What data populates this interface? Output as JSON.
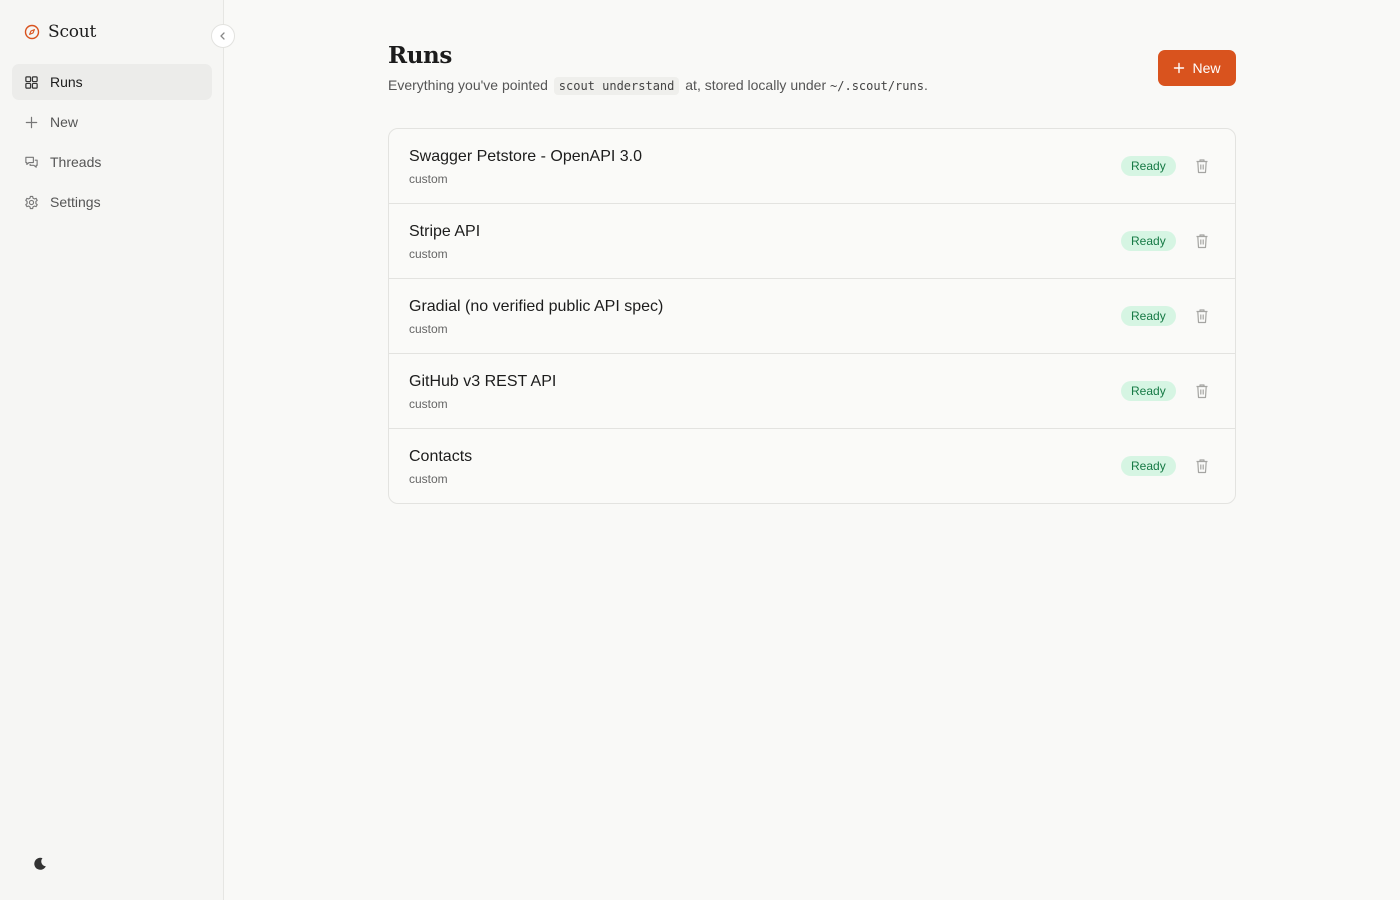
{
  "app": {
    "name": "Scout",
    "brand_icon": "compass-icon",
    "accent_color": "#d9531e"
  },
  "sidebar": {
    "items": [
      {
        "label": "Runs",
        "icon": "grid-icon",
        "active": true
      },
      {
        "label": "New",
        "icon": "plus-icon",
        "active": false
      },
      {
        "label": "Threads",
        "icon": "chat-bubbles-icon",
        "active": false
      },
      {
        "label": "Settings",
        "icon": "gear-icon",
        "active": false
      }
    ],
    "collapse_icon": "chevron-left-icon",
    "theme_icon": "moon-icon"
  },
  "main": {
    "title": "Runs",
    "subtitle": {
      "part1": "Everything you've pointed",
      "command": "scout understand",
      "part2": "at, stored locally under",
      "path": "~/.scout/runs",
      "part3": "."
    },
    "new_button_label": "New"
  },
  "runs": [
    {
      "name": "Swagger Petstore - OpenAPI 3.0",
      "source": "custom",
      "status": "Ready"
    },
    {
      "name": "Stripe API",
      "source": "custom",
      "status": "Ready"
    },
    {
      "name": "Gradial (no verified public API spec)",
      "source": "custom",
      "status": "Ready"
    },
    {
      "name": "GitHub v3 REST API",
      "source": "custom",
      "status": "Ready"
    },
    {
      "name": "Contacts",
      "source": "custom",
      "status": "Ready"
    }
  ]
}
